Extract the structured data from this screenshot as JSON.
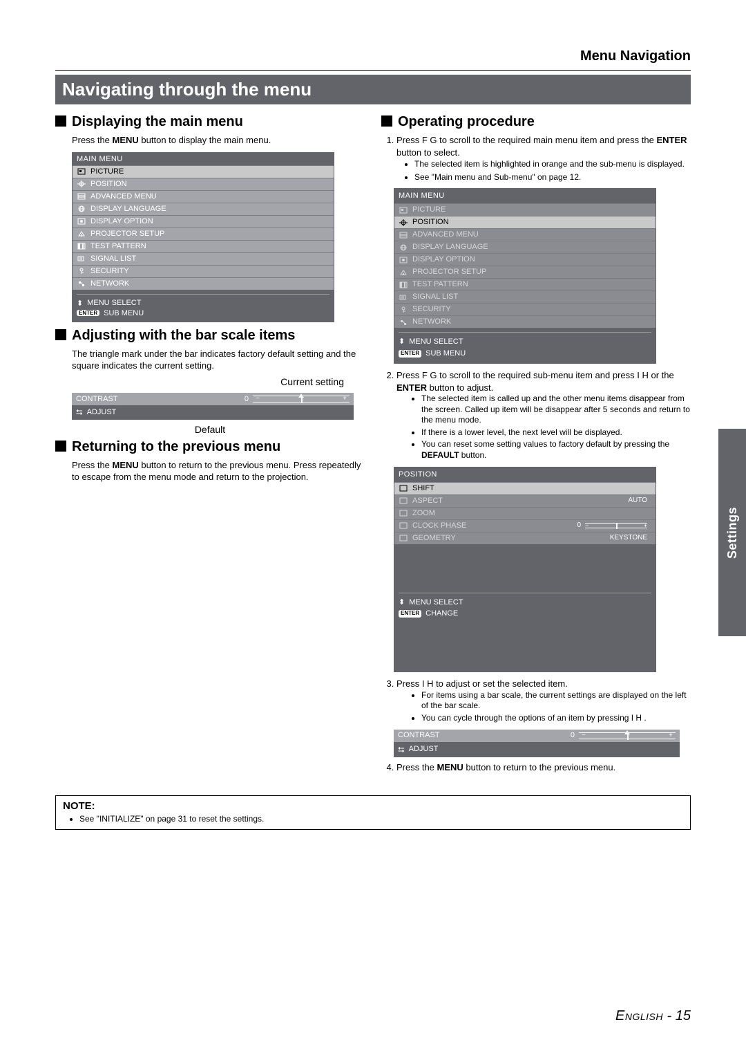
{
  "header": {
    "section": "Menu Navigation"
  },
  "title": "Navigating through the menu",
  "side_tab": "Settings",
  "footer": {
    "language": "English",
    "page": "15"
  },
  "left": {
    "displaying": {
      "heading": "Displaying the main menu",
      "body": "Press the MENU button to display the main menu.",
      "body_pre": "Press the ",
      "body_bold": "MENU",
      "body_post": " button to display the main menu."
    },
    "main_menu_panel": {
      "title": "MAIN MENU",
      "items": [
        {
          "label": "PICTURE",
          "state": "sel",
          "icon": "picture-icon"
        },
        {
          "label": "POSITION",
          "state": "norm",
          "icon": "position-icon"
        },
        {
          "label": "ADVANCED MENU",
          "state": "norm",
          "icon": "advanced-icon"
        },
        {
          "label": "DISPLAY LANGUAGE",
          "state": "norm",
          "icon": "language-icon"
        },
        {
          "label": "DISPLAY OPTION",
          "state": "norm",
          "icon": "option-icon"
        },
        {
          "label": "PROJECTOR SETUP",
          "state": "norm",
          "icon": "setup-icon"
        },
        {
          "label": "TEST PATTERN",
          "state": "norm",
          "icon": "test-icon"
        },
        {
          "label": "SIGNAL LIST",
          "state": "norm",
          "icon": "signal-icon"
        },
        {
          "label": "SECURITY",
          "state": "norm",
          "icon": "security-icon"
        },
        {
          "label": "NETWORK",
          "state": "norm",
          "icon": "network-icon"
        }
      ],
      "footer1": "MENU SELECT",
      "footer2": "SUB MENU",
      "footer2_icon": "ENTER"
    },
    "adjusting": {
      "heading": "Adjusting with the bar scale items",
      "body": "The triangle mark under the bar indicates factory default setting and the square indicates the current setting.",
      "current_label": "Current setting",
      "default_label": "Default",
      "bar": {
        "name": "CONTRAST",
        "value": "0",
        "foot": "ADJUST"
      }
    },
    "returning": {
      "heading": "Returning to the previous menu",
      "pre": "Press the ",
      "bold": "MENU",
      "post": " button to return to the previous menu. Press repeatedly to escape from the menu mode and return to the projection."
    }
  },
  "right": {
    "operating": {
      "heading": "Operating procedure"
    },
    "step1": {
      "text_pre": "Press F   G  to scroll to the required main menu item and press the ",
      "text_bold": "ENTER",
      "text_post": " button to select.",
      "b1": "The selected item is highlighted in orange and the sub-menu is displayed.",
      "b2": "See \"Main menu and Sub-menu\" on page 12."
    },
    "main_menu_panel2": {
      "title": "MAIN MENU",
      "items": [
        {
          "label": "PICTURE",
          "state": "dim",
          "icon": "picture-icon"
        },
        {
          "label": "POSITION",
          "state": "sel",
          "icon": "position-icon"
        },
        {
          "label": "ADVANCED MENU",
          "state": "dim",
          "icon": "advanced-icon"
        },
        {
          "label": "DISPLAY LANGUAGE",
          "state": "dim",
          "icon": "language-icon"
        },
        {
          "label": "DISPLAY OPTION",
          "state": "dim",
          "icon": "option-icon"
        },
        {
          "label": "PROJECTOR SETUP",
          "state": "dim",
          "icon": "setup-icon"
        },
        {
          "label": "TEST PATTERN",
          "state": "dim",
          "icon": "test-icon"
        },
        {
          "label": "SIGNAL LIST",
          "state": "dim",
          "icon": "signal-icon"
        },
        {
          "label": "SECURITY",
          "state": "dim",
          "icon": "security-icon"
        },
        {
          "label": "NETWORK",
          "state": "dim",
          "icon": "network-icon"
        }
      ],
      "footer1": "MENU SELECT",
      "footer2": "SUB MENU",
      "footer2_icon": "ENTER"
    },
    "step2": {
      "text_pre": "Press F   G  to scroll to the required sub-menu item and press I   H  or the ",
      "text_bold": "ENTER",
      "text_post": " button to adjust.",
      "b1": "The selected item is called up and the other menu items disappear from the screen. Called up item will be disappear after 5 seconds and return to the menu mode.",
      "b2": "If there is a lower level, the next level will be displayed.",
      "b3_pre": "You can reset some setting values to factory default by pressing the ",
      "b3_bold": "DEFAULT",
      "b3_post": " button."
    },
    "position_panel": {
      "title": "POSITION",
      "items": [
        {
          "label": "SHIFT",
          "value": "",
          "state": "sel"
        },
        {
          "label": "ASPECT",
          "value": "AUTO",
          "state": "dim"
        },
        {
          "label": "ZOOM",
          "value": "",
          "state": "dim"
        },
        {
          "label": "CLOCK PHASE",
          "value": "0",
          "state": "dim",
          "bar": true
        },
        {
          "label": "GEOMETRY",
          "value": "KEYSTONE",
          "state": "dim"
        }
      ],
      "footer1": "MENU SELECT",
      "footer2": "CHANGE",
      "footer2_icon": "ENTER"
    },
    "step3": {
      "text": "Press I   H to adjust or set the selected item.",
      "b1": "For items using a bar scale, the current settings are displayed on the left of the bar scale.",
      "b2": "You can cycle through the options of an item by pressing I H ."
    },
    "bar2": {
      "name": "CONTRAST",
      "value": "0",
      "foot": "ADJUST"
    },
    "step4": {
      "pre": "Press the ",
      "bold": "MENU",
      "post": " button to return to the previous menu."
    }
  },
  "note": {
    "title": "NOTE:",
    "b1": "See \"INITIALIZE\" on page 31 to reset the settings."
  }
}
